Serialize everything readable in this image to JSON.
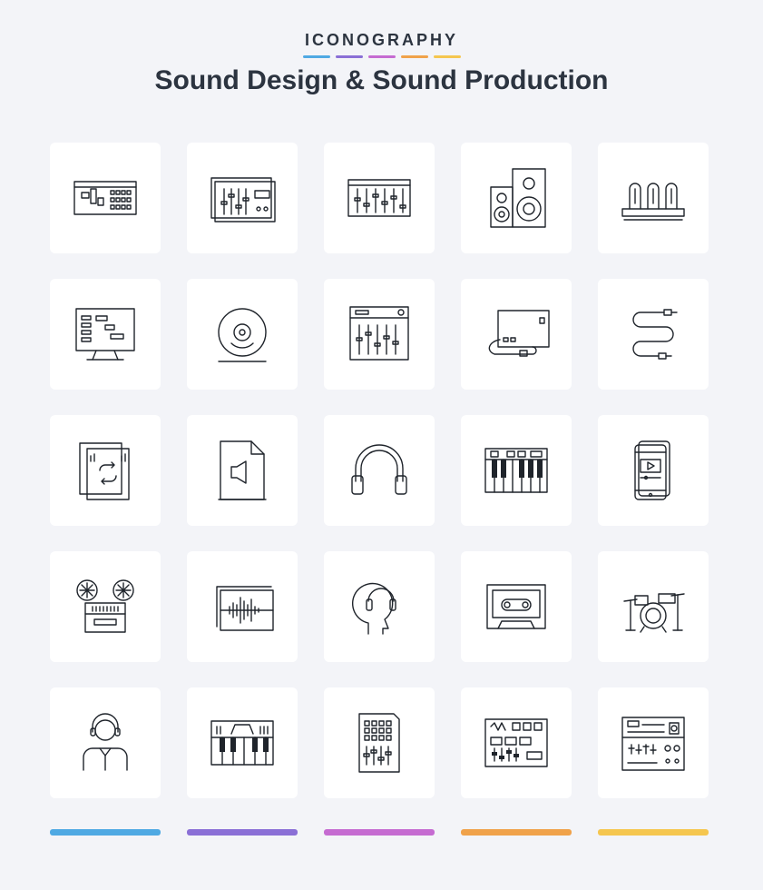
{
  "header": {
    "brand": "ICONOGRAPHY",
    "title": "Sound Design & Sound Production"
  },
  "colors": {
    "background": "#f3f4f8",
    "tile": "#ffffff",
    "stroke": "#1f242b",
    "accents": [
      "#4fa9e3",
      "#8a6fd6",
      "#c56bd1",
      "#f0a24a",
      "#f5c64f"
    ]
  },
  "icons": [
    "daw-window-icon",
    "equalizer-window-icon",
    "mixer-faders-icon",
    "speakers-icon",
    "vacuum-tubes-icon",
    "computer-sequencer-icon",
    "vinyl-disc-icon",
    "mixing-console-icon",
    "audio-interface-cable-icon",
    "audio-cable-icon",
    "loop-file-icon",
    "audio-file-icon",
    "headphones-icon",
    "midi-keyboard-icon",
    "mobile-player-icon",
    "tape-reels-icon",
    "waveform-window-icon",
    "headphones-head-icon",
    "cassette-icon",
    "drum-kit-icon",
    "sound-engineer-icon",
    "synthesizer-icon",
    "launchpad-icon",
    "drum-machine-icon",
    "rack-unit-icon"
  ]
}
